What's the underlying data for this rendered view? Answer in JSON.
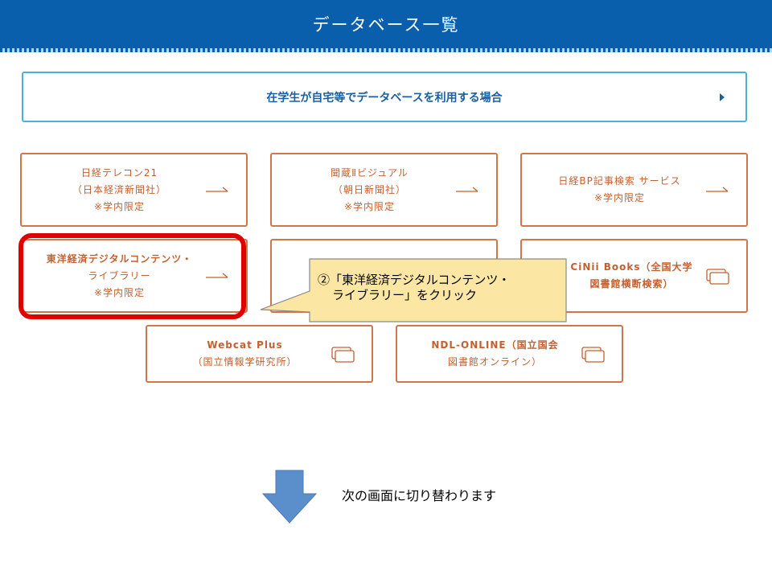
{
  "header": {
    "title": "データベース一覧"
  },
  "banner": {
    "label": "在学生が自宅等でデータベースを利用する場合",
    "icon": "chevron-right-icon"
  },
  "cards": [
    {
      "name": "nikkei-telecon21",
      "line1": "日経テレコン21",
      "line2": "（日本経済新聞社）",
      "line3": "※学内限定",
      "icon": "arrow-right-icon"
    },
    {
      "name": "kikuzo-visual",
      "line1": "聞蔵Ⅱビジュアル",
      "line2": "（朝日新聞社）",
      "line3": "※学内限定",
      "icon": "arrow-right-icon"
    },
    {
      "name": "nikkei-bp",
      "line1": "日経BP記事検索 サービス",
      "line2": "※学内限定",
      "icon": "arrow-right-icon"
    },
    {
      "name": "toyo-keizai-digital",
      "line1": "東洋経済デジタルコンテンツ・",
      "line2": "ライブラリー",
      "line3": "※学内限定",
      "icon": "arrow-right-icon"
    },
    {
      "name": "hidden-card",
      "line1": "",
      "line2": "",
      "icon": ""
    },
    {
      "name": "cinii-books",
      "line1": "CiNii Books（全国大学",
      "line2": "図書館横断検索）",
      "icon": "new-window-icon"
    },
    {
      "name": "webcat-plus",
      "line1": "Webcat Plus",
      "line2": "（国立情報学研究所）",
      "icon": "new-window-icon"
    },
    {
      "name": "ndl-online",
      "line1": "NDL-ONLINE（国立国会",
      "line2": "図書館オンライン）",
      "icon": "new-window-icon"
    }
  ],
  "callout": {
    "line1": "②「東洋経済デジタルコンテンツ・",
    "line2": "ライブラリー」をクリック"
  },
  "footer": {
    "next_text": "次の画面に切り替わります"
  },
  "colors": {
    "header_bg": "#0a5fad",
    "banner_border": "#4db0da",
    "card_border": "#d0764a",
    "card_text": "#c4602f",
    "highlight": "#e00000",
    "callout_bg": "#fbe7a3",
    "arrow_fill": "#5b8fcc"
  }
}
